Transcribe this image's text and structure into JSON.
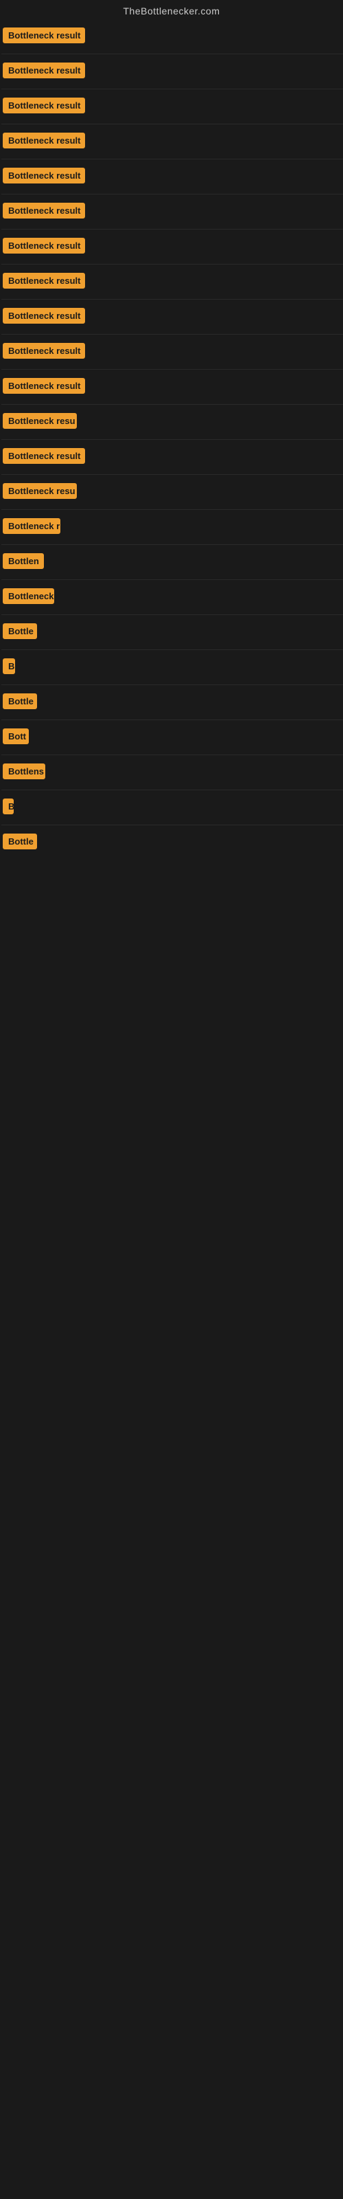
{
  "site": {
    "title": "TheBottlenecker.com"
  },
  "rows": [
    {
      "id": 1,
      "label": "Bottleneck result",
      "width": 120
    },
    {
      "id": 2,
      "label": "Bottleneck result",
      "width": 120
    },
    {
      "id": 3,
      "label": "Bottleneck result",
      "width": 120
    },
    {
      "id": 4,
      "label": "Bottleneck result",
      "width": 120
    },
    {
      "id": 5,
      "label": "Bottleneck result",
      "width": 120
    },
    {
      "id": 6,
      "label": "Bottleneck result",
      "width": 120
    },
    {
      "id": 7,
      "label": "Bottleneck result",
      "width": 120
    },
    {
      "id": 8,
      "label": "Bottleneck result",
      "width": 120
    },
    {
      "id": 9,
      "label": "Bottleneck result",
      "width": 120
    },
    {
      "id": 10,
      "label": "Bottleneck result",
      "width": 120
    },
    {
      "id": 11,
      "label": "Bottleneck result",
      "width": 120
    },
    {
      "id": 12,
      "label": "Bottleneck resu",
      "width": 108
    },
    {
      "id": 13,
      "label": "Bottleneck result",
      "width": 120
    },
    {
      "id": 14,
      "label": "Bottleneck resu",
      "width": 108
    },
    {
      "id": 15,
      "label": "Bottleneck r",
      "width": 84
    },
    {
      "id": 16,
      "label": "Bottlen",
      "width": 60
    },
    {
      "id": 17,
      "label": "Bottleneck",
      "width": 75
    },
    {
      "id": 18,
      "label": "Bottle",
      "width": 50
    },
    {
      "id": 19,
      "label": "B",
      "width": 18
    },
    {
      "id": 20,
      "label": "Bottle",
      "width": 50
    },
    {
      "id": 21,
      "label": "Bott",
      "width": 38
    },
    {
      "id": 22,
      "label": "Bottlens",
      "width": 62
    },
    {
      "id": 23,
      "label": "B",
      "width": 16
    },
    {
      "id": 24,
      "label": "Bottle",
      "width": 50
    }
  ]
}
